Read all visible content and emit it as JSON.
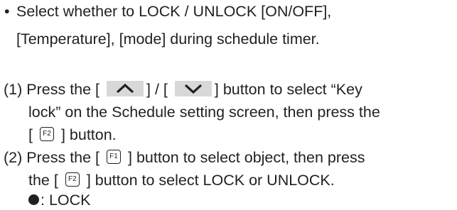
{
  "bullet": {
    "mark": "•",
    "line1": "Select whether to LOCK / UNLOCK [ON/OFF],",
    "line2": "[Temperature], [mode] during schedule timer."
  },
  "step1": {
    "number": "(1)",
    "line1_a": "Press the [",
    "line1_b": "] / [",
    "line1_c": "] button to select “Key",
    "line2": "lock” on the Schedule setting screen, then press the",
    "line3_a": "[",
    "line3_b": "] button.",
    "up_key_icon": "chevron-up-icon",
    "down_key_icon": "chevron-down-icon",
    "f2_key": "F2"
  },
  "step2": {
    "number": "(2)",
    "line1_a": "Press the [",
    "line1_b": "] button to select object, then press",
    "line2_a": "the [",
    "line2_b": "] button to select LOCK or UNLOCK.",
    "f1_key": "F1",
    "f2_key": "F2",
    "legend_label": ": LOCK"
  }
}
